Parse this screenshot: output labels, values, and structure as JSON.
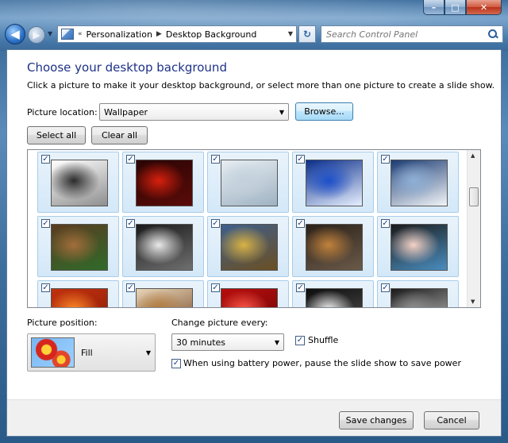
{
  "window": {
    "caption_buttons": [
      {
        "name": "minimize-button",
        "glyph": "–"
      },
      {
        "name": "maximize-button",
        "glyph": "□"
      },
      {
        "name": "close-button",
        "glyph": "✕"
      }
    ]
  },
  "navbar": {
    "back_glyph": "◀",
    "forward_glyph": "▶",
    "breadcrumb_overflow": "«",
    "breadcrumbs": [
      "Personalization",
      "Desktop Background"
    ],
    "breadcrumb_separator": "▶",
    "refresh_glyph": "↻",
    "search_placeholder": "Search Control Panel"
  },
  "main": {
    "title": "Choose your desktop background",
    "subtitle": "Click a picture to make it your desktop background, or select more than one picture to create a slide show.",
    "picture_location_label": "Picture location:",
    "picture_location_value": "Wallpaper",
    "browse_label": "Browse...",
    "select_all_label": "Select all",
    "clear_all_label": "Clear all",
    "check_glyph": "✓"
  },
  "gallery": {
    "thumbnails": [
      {
        "name": "penguins",
        "colors": [
          "#ffffff",
          "#2b2b2b",
          "#8f8f8f"
        ]
      },
      {
        "name": "red-orb",
        "colors": [
          "#2a0505",
          "#d8200d",
          "#5a0b08"
        ]
      },
      {
        "name": "polar-bears",
        "colors": [
          "#e7eef3",
          "#c4d1dc",
          "#9fb2c2"
        ]
      },
      {
        "name": "blue-canvas",
        "colors": [
          "#0a2e8a",
          "#1c4fc9",
          "#e8f0ff"
        ]
      },
      {
        "name": "mountain-lake",
        "colors": [
          "#1c3c73",
          "#8fb0d6",
          "#f2f5f8"
        ]
      },
      {
        "name": "lynx",
        "colors": [
          "#5a3b20",
          "#a36d3b",
          "#2f6b2a"
        ]
      },
      {
        "name": "snow-cat",
        "colors": [
          "#1a1a1a",
          "#e9e9e9",
          "#6f6f6f"
        ]
      },
      {
        "name": "canyon",
        "colors": [
          "#3d5f8c",
          "#d9b245",
          "#6b4f22"
        ]
      },
      {
        "name": "desert-road",
        "colors": [
          "#2b2118",
          "#c2823b",
          "#6a5a4a"
        ]
      },
      {
        "name": "abstract-face",
        "colors": [
          "#1a1a1a",
          "#f4d2c6",
          "#4a8ec0"
        ]
      },
      {
        "name": "orange-flower",
        "colors": [
          "#c0310f",
          "#ff8a2a",
          "#8a1a05"
        ]
      },
      {
        "name": "kittens",
        "colors": [
          "#e8d4b8",
          "#b37a3a",
          "#6a3e1a"
        ]
      },
      {
        "name": "red-petals",
        "colors": [
          "#b70d0d",
          "#ff5a4a",
          "#6a0505"
        ]
      },
      {
        "name": "piano-keys",
        "colors": [
          "#0d0d0d",
          "#efefef",
          "#555555"
        ]
      },
      {
        "name": "dark-landscape",
        "colors": [
          "#1a1a1a",
          "#8f8f8f",
          "#cfcfcf"
        ]
      }
    ],
    "scroll_up_glyph": "▲",
    "scroll_down_glyph": "▼"
  },
  "options": {
    "picture_position_label": "Picture position:",
    "picture_position_value": "Fill",
    "change_every_label": "Change picture every:",
    "change_every_value": "30 minutes",
    "shuffle_label": "Shuffle",
    "shuffle_checked": true,
    "battery_label": "When using battery power, pause the slide show to save power",
    "battery_checked": true,
    "dropdown_glyph": "▼"
  },
  "footer": {
    "save_label": "Save changes",
    "cancel_label": "Cancel"
  }
}
